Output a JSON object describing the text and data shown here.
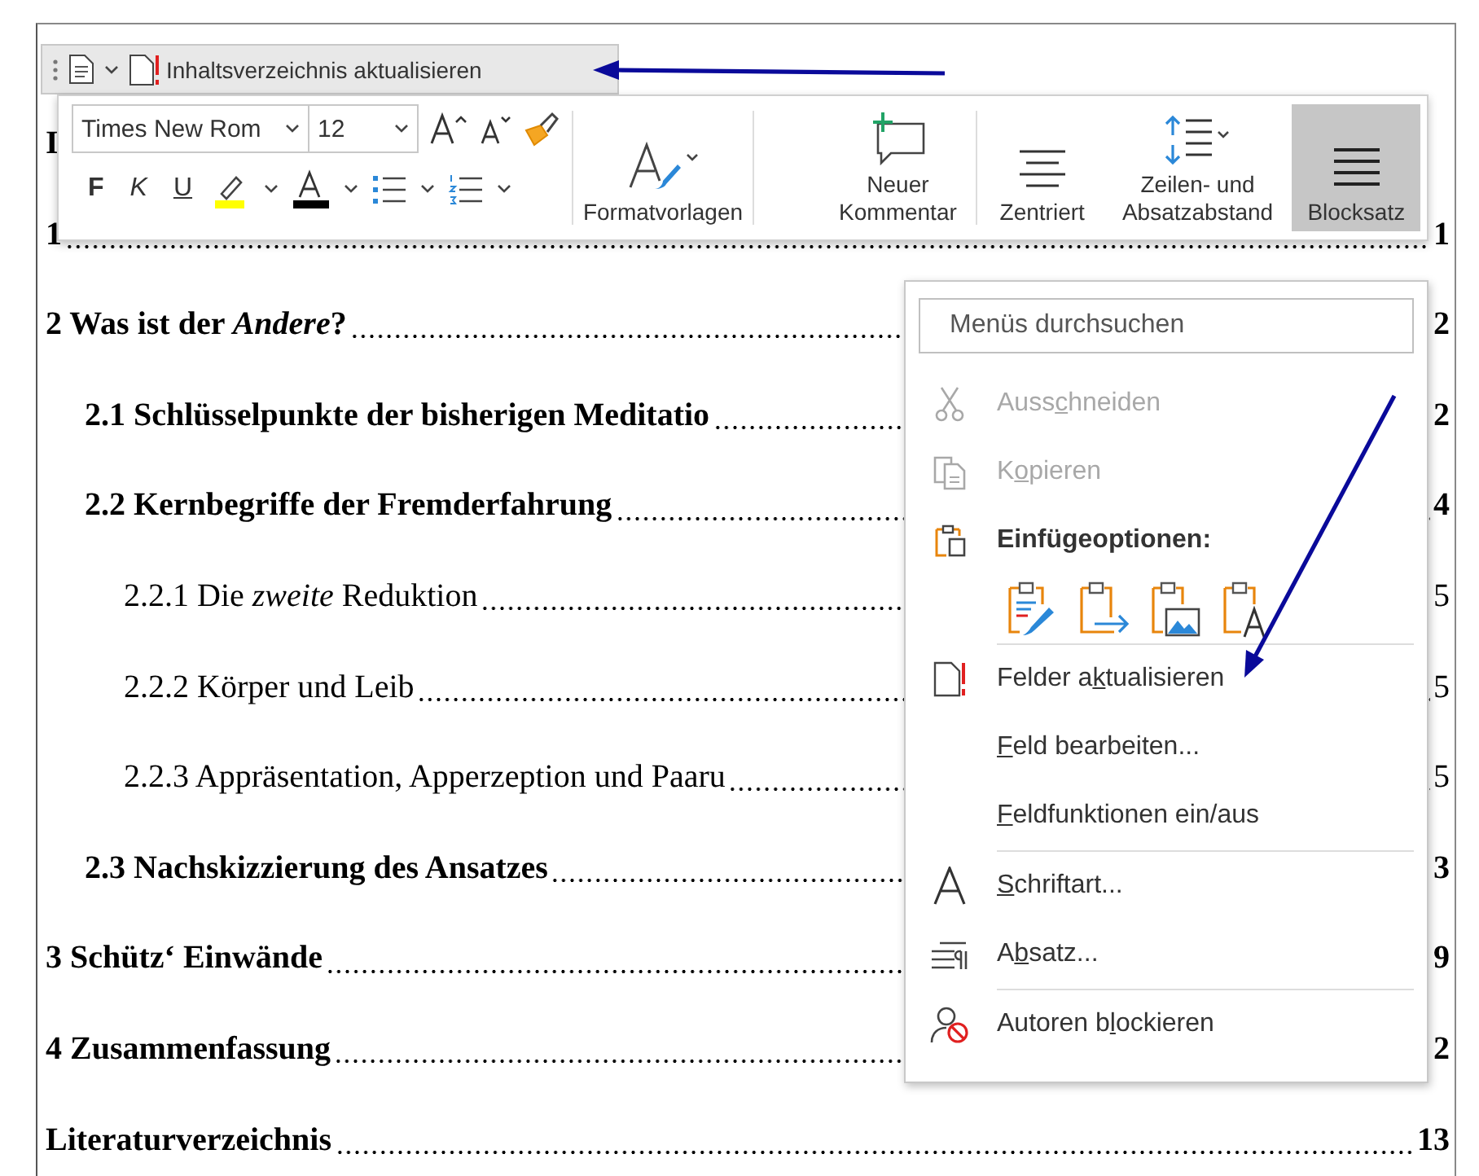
{
  "document": {
    "entries": [
      {
        "title": "I"
      },
      {
        "title": "1",
        "page": "1"
      },
      {
        "title": "2 Was ist der *Andere*?",
        "page": "2",
        "children": [
          {
            "title": "2.1 Schlüsselpunkte der bisherigen Meditatio",
            "page": "2"
          },
          {
            "title": "2.2 Kernbegriffe der Fremderfahrung",
            "page": "4",
            "children": [
              {
                "title": "2.2.1 Die *zweite* Reduktion",
                "page": "5"
              },
              {
                "title": "2.2.2 Körper und Leib",
                "page": "5"
              },
              {
                "title": "2.2.3 Appräsentation, Apperzeption und Paaru",
                "page": "5"
              }
            ]
          },
          {
            "title": "2.3 Nachskizzierung des Ansatzes",
            "page": "3"
          }
        ]
      },
      {
        "title": "3 Schütz‘ Einwände",
        "page": "9"
      },
      {
        "title": "4 Zusammenfassung",
        "page": "2"
      },
      {
        "title": "Literaturverzeichnis",
        "page": "13"
      }
    ]
  },
  "quick_bar": {
    "label": "Inhaltsverzeichnis aktualisieren"
  },
  "mini_toolbar": {
    "font": "Times New Rom",
    "size": "12",
    "format_buttons": [
      {
        "label": "F",
        "kind": "bold"
      },
      {
        "label": "K",
        "kind": "italic"
      },
      {
        "label": "U",
        "kind": "underline"
      }
    ],
    "big_buttons": [
      {
        "kind": "styles",
        "lines": [
          "Formatvorlagen"
        ],
        "selected": false
      },
      {
        "kind": "comment",
        "lines": [
          "Neuer",
          "Kommentar"
        ],
        "selected": false
      },
      {
        "kind": "center",
        "lines": [
          "Zentriert"
        ],
        "selected": false
      },
      {
        "kind": "spacing",
        "lines": [
          "Zeilen- und",
          "Absatzabstand"
        ],
        "selected": false
      },
      {
        "kind": "justify",
        "lines": [
          "Blocksatz"
        ],
        "selected": true
      }
    ]
  },
  "context_menu": {
    "search": {
      "placeholder": "Menüs durchsuchen"
    },
    "items": [
      {
        "kind": "cut",
        "label": {
          "before": "Auss",
          "key": "c",
          "after": "hneiden"
        },
        "disabled": true
      },
      {
        "kind": "copy",
        "label": {
          "before": "K",
          "key": "o",
          "after": "pieren"
        },
        "disabled": true
      },
      {
        "kind": "paste_heading",
        "label": "Einfügeoptionen:"
      },
      {
        "kind": "paste_options"
      },
      {
        "kind": "separator"
      },
      {
        "kind": "field_update",
        "label": {
          "before": "Felder a",
          "key": "k",
          "after": "tualisieren"
        },
        "disabled": false
      },
      {
        "kind": "plain",
        "label": {
          "key": "F",
          "after": "eld bearbeiten..."
        },
        "disabled": false
      },
      {
        "kind": "plain",
        "label": {
          "key": "F",
          "after": "eldfunktionen ein/aus"
        },
        "disabled": false
      },
      {
        "kind": "separator"
      },
      {
        "kind": "font",
        "label": {
          "key": "S",
          "after": "chriftart..."
        },
        "disabled": false
      },
      {
        "kind": "paragraph",
        "label": {
          "before": "A",
          "key": "b",
          "after": "satz..."
        },
        "disabled": false
      },
      {
        "kind": "separator"
      },
      {
        "kind": "block_authors",
        "label": {
          "before": "Autoren b",
          "key": "l",
          "after": "ockieren"
        },
        "disabled": false
      }
    ]
  }
}
